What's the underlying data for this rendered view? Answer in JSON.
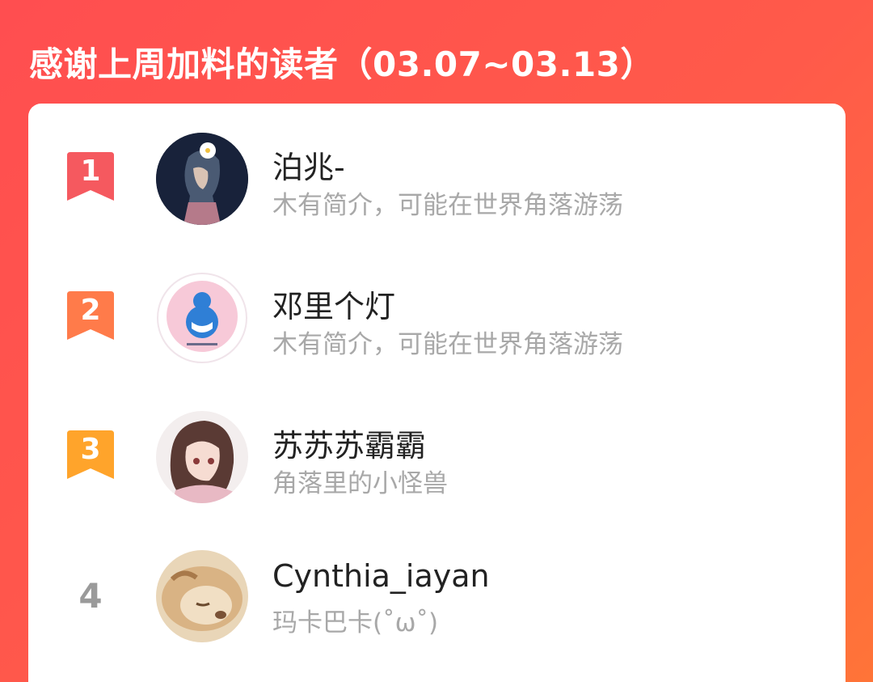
{
  "header": {
    "title": "感谢上周加料的读者（03.07~03.13）"
  },
  "colors": {
    "rank1": "#f5595f",
    "rank2": "#ff7b4a",
    "rank3": "#ffa42b",
    "rank_plain": "#9a9a9a"
  },
  "readers": [
    {
      "rank": "1",
      "name": "泊兆-",
      "desc": "木有简介，可能在世界角落游荡",
      "avatar": "avatar-girl-flower-icon"
    },
    {
      "rank": "2",
      "name": "邓里个灯",
      "desc": "木有简介，可能在世界角落游荡",
      "avatar": "avatar-blue-gourd-icon"
    },
    {
      "rank": "3",
      "name": "苏苏苏霸霸",
      "desc": "角落里的小怪兽",
      "avatar": "avatar-anime-girl-icon"
    },
    {
      "rank": "4",
      "name": "Cynthia_iayan",
      "desc": "玛卡巴卡(˚ω˚)",
      "avatar": "avatar-sleeping-dog-icon"
    }
  ]
}
